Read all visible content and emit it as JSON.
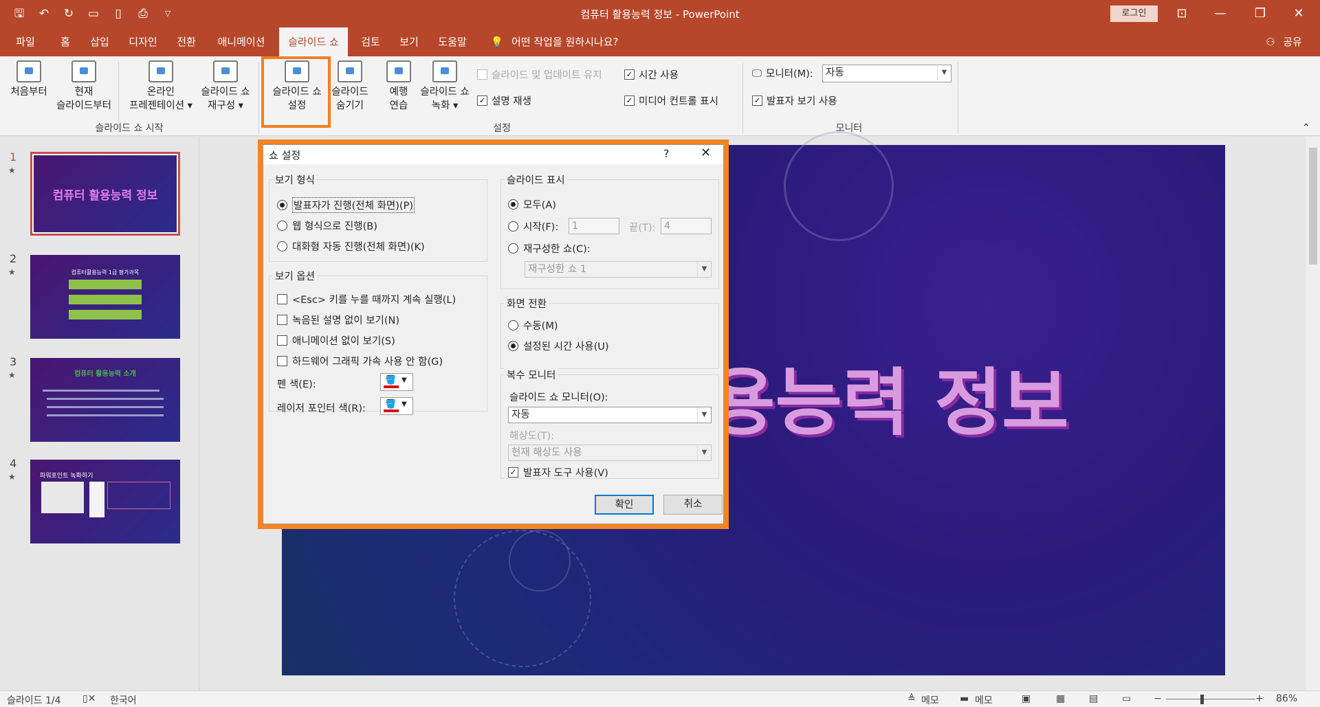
{
  "window": {
    "title": "컴퓨터 활용능력 정보  -  PowerPoint",
    "login_label": "로그인",
    "qat_icons": [
      "save-icon",
      "undo-icon",
      "redo-icon",
      "present-icon",
      "new-icon",
      "print-preview-icon",
      "customize-icon"
    ]
  },
  "menu": {
    "tabs": [
      "파일",
      "홈",
      "삽입",
      "디자인",
      "전환",
      "애니메이션",
      "슬라이드 쇼",
      "검토",
      "보기",
      "도움말"
    ],
    "active_tab": "슬라이드 쇼",
    "tell_me": "어떤 작업을 원하시나요?",
    "share": "공유"
  },
  "ribbon": {
    "from_beginning": "처음부터",
    "from_current_1": "현재",
    "from_current_2": "슬라이드부터",
    "online_1": "온라인",
    "online_2": "프레젠테이션 ▾",
    "custom_1": "슬라이드 쇼",
    "custom_2": "재구성 ▾",
    "group_start": "슬라이드 쇼 시작",
    "setup_1": "슬라이드 쇼",
    "setup_2": "설정",
    "hide_1": "슬라이드",
    "hide_2": "숨기기",
    "rehearse_1": "예행",
    "rehearse_2": "연습",
    "record_1": "슬라이드 쇼",
    "record_2": "녹화 ▾",
    "keep_updated": "슬라이드 및 업데이트 유지",
    "play_narration": "설명 재생",
    "use_timings": "시간 사용",
    "show_media_controls": "미디어 컨트롤 표시",
    "group_setup": "설정",
    "monitor_label": "모니터(M):",
    "monitor_value": "자동",
    "presenter_view": "발표자 보기 사용",
    "group_monitor": "모니터"
  },
  "slides": [
    {
      "num": "1",
      "title": "컴퓨터 활용능력 정보"
    },
    {
      "num": "2",
      "title": "컴퓨터활용능력 1급 평가과목"
    },
    {
      "num": "3",
      "title": "컴퓨터 활용능력 소개"
    },
    {
      "num": "4",
      "title": "파워포인트 녹화하기"
    }
  ],
  "main_slide": {
    "title_visible": "용능력 정보"
  },
  "dialog": {
    "title": "쇼 설정",
    "help": "?",
    "show_type": {
      "label": "보기 형식",
      "options": [
        "발표자가 진행(전체 화면)(P)",
        "웹 형식으로 진행(B)",
        "대화형 자동 진행(전체 화면)(K)"
      ],
      "selected": 0
    },
    "show_options": {
      "label": "보기 옵션",
      "loop": "<Esc> 키를 누를 때까지 계속 실행(L)",
      "no_narration": "녹음된 설명 없이 보기(N)",
      "no_animation": "애니메이션 없이 보기(S)",
      "disable_hw": "하드웨어 그래픽 가속 사용 안 함(G)",
      "pen_color": "펜 색(E):",
      "laser_color": "레이저 포인터 색(R):"
    },
    "show_slides": {
      "label": "슬라이드 표시",
      "all": "모두(A)",
      "from": "시작(F):",
      "from_value": "1",
      "to": "끝(T):",
      "to_value": "4",
      "custom": "재구성한 쇼(C):",
      "custom_value": "재구성한 쇼 1"
    },
    "advance": {
      "label": "화면 전환",
      "manual": "수동(M)",
      "timings": "설정된 시간 사용(U)"
    },
    "multi_monitor": {
      "label": "복수 모니터",
      "monitor_label": "슬라이드 쇼 모니터(O):",
      "monitor_value": "자동",
      "resolution_label": "해상도(T):",
      "resolution_value": "현재 해상도 사용",
      "presenter_tools": "발표자 도구 사용(V)"
    },
    "ok": "확인",
    "cancel": "취소"
  },
  "status": {
    "slide_counter": "슬라이드 1/4",
    "language": "한국어",
    "notes": "메모",
    "comments": "메모",
    "zoom": "86%"
  }
}
